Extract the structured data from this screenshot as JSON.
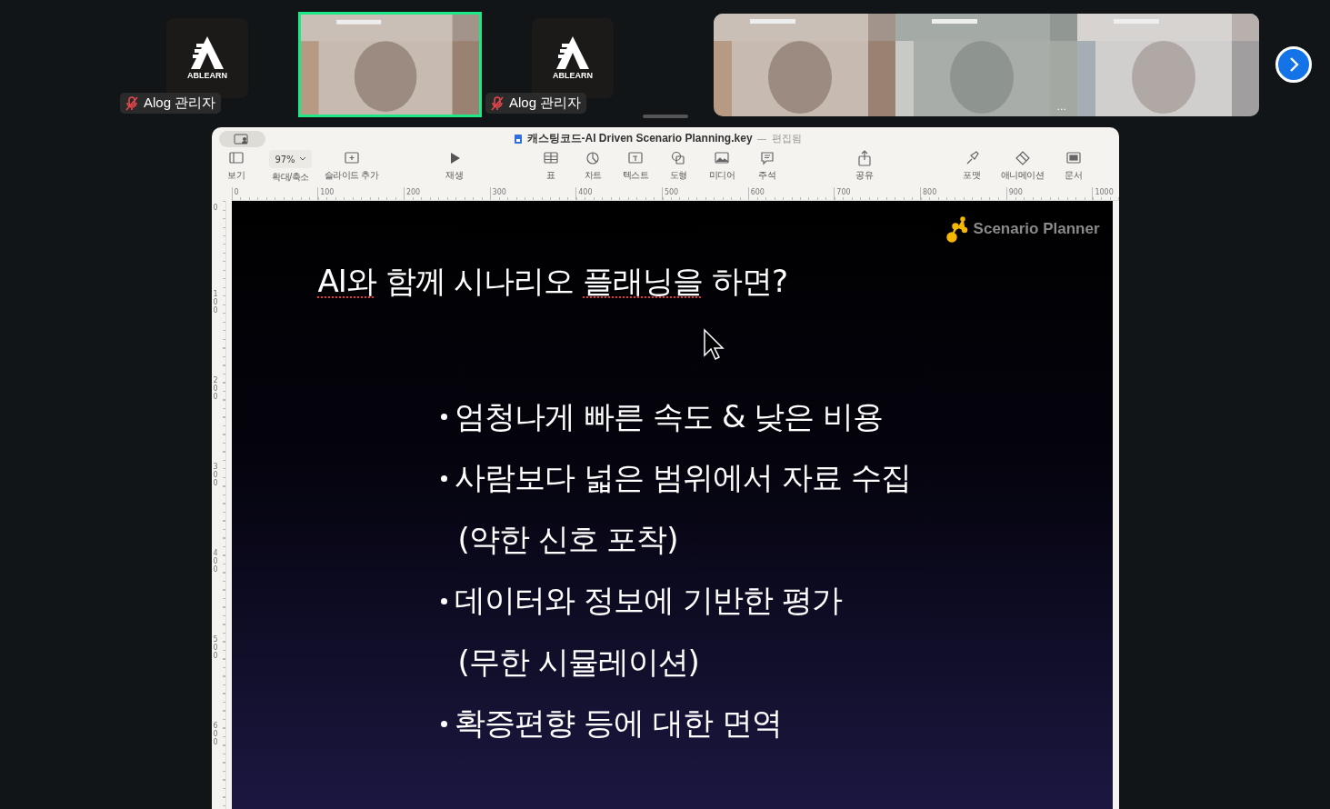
{
  "participants": [
    {
      "kind": "avatar",
      "logo_text": "ABLEARN",
      "name": "Alog 관리자",
      "muted": true,
      "speaking": false
    },
    {
      "kind": "video",
      "speaking": true
    },
    {
      "kind": "avatar",
      "logo_text": "ABLEARN",
      "name": "Alog 관리자",
      "muted": true,
      "speaking": false
    }
  ],
  "gallery": [
    {
      "kind": "picture"
    },
    {
      "kind": "picture",
      "more": "..."
    },
    {
      "kind": "picture"
    }
  ],
  "window": {
    "title": "캐스팅코드-AI Driven Scenario Planning.key",
    "separator": "—",
    "status": "편집됨"
  },
  "toolbar": [
    {
      "kind": "view",
      "label": "보기"
    },
    {
      "kind": "zoom",
      "label": "확대/축소",
      "value": "97%"
    },
    {
      "kind": "add-slide",
      "label": "슬라이드 추가"
    },
    {
      "kind": "play",
      "label": "재생"
    },
    {
      "kind": "table",
      "label": "표"
    },
    {
      "kind": "chart",
      "label": "차트"
    },
    {
      "kind": "text",
      "label": "텍스트"
    },
    {
      "kind": "shape",
      "label": "도형"
    },
    {
      "kind": "media",
      "label": "미디어"
    },
    {
      "kind": "comment",
      "label": "주석"
    },
    {
      "kind": "share",
      "label": "공유"
    },
    {
      "kind": "format",
      "label": "포맷"
    },
    {
      "kind": "animate",
      "label": "애니메이션"
    },
    {
      "kind": "document",
      "label": "문서"
    }
  ],
  "ruler_h": [
    "0",
    "100",
    "200",
    "300",
    "400",
    "500",
    "600",
    "700",
    "800",
    "900",
    "1000"
  ],
  "ruler_v": [
    "0",
    "100",
    "200",
    "300",
    "400",
    "500",
    "600"
  ],
  "slide": {
    "brand": "Scenario Planner",
    "title": [
      {
        "text": "AI와",
        "misspelled": true
      },
      {
        "text": " 함께 시나리오 ",
        "misspelled": false
      },
      {
        "text": "플래닝을",
        "misspelled": true
      },
      {
        "text": " 하면?",
        "misspelled": false
      }
    ],
    "lines": [
      {
        "kind": "bullet",
        "text": "엄청나게 빠른 속도 & 낮은 비용"
      },
      {
        "kind": "bullet",
        "text": "사람보다 넓은 범위에서 자료 수집"
      },
      {
        "kind": "continuation",
        "text": "(약한 신호 포착)"
      },
      {
        "kind": "bullet",
        "text": "데이터와 정보에 기반한 평가"
      },
      {
        "kind": "continuation",
        "text": "(무한 시뮬레이션)"
      },
      {
        "kind": "bullet",
        "text": "확증편향 등에 대한 면역"
      }
    ]
  }
}
